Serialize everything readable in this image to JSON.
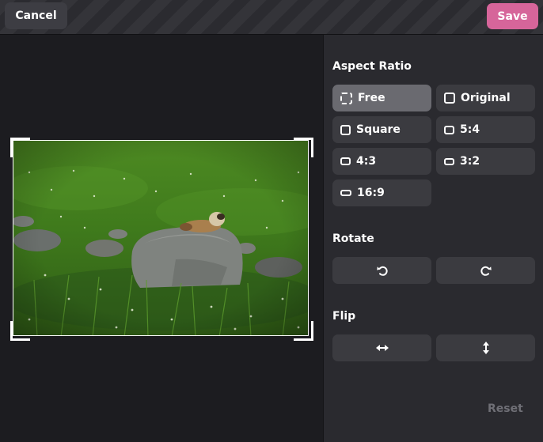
{
  "header": {
    "cancel_label": "Cancel",
    "save_label": "Save"
  },
  "panel": {
    "aspect_ratio_title": "Aspect Ratio",
    "aspect_options": [
      {
        "label": "Free",
        "icon": "dashed-square-icon",
        "active": true
      },
      {
        "label": "Original",
        "icon": "square-icon"
      },
      {
        "label": "Square",
        "icon": "square-icon"
      },
      {
        "label": "5:4",
        "icon": "ratio-5-4-icon"
      },
      {
        "label": "4:3",
        "icon": "ratio-4-3-icon"
      },
      {
        "label": "3:2",
        "icon": "ratio-3-2-icon"
      },
      {
        "label": "16:9",
        "icon": "ratio-16-9-icon"
      }
    ],
    "rotate_title": "Rotate",
    "flip_title": "Flip",
    "reset_label": "Reset"
  },
  "colors": {
    "accent": "#d6659a",
    "selected": "#6a6a70",
    "button": "#3b3b40",
    "panel": "#2a2a2f",
    "disabled_text": "#6f6f76"
  }
}
